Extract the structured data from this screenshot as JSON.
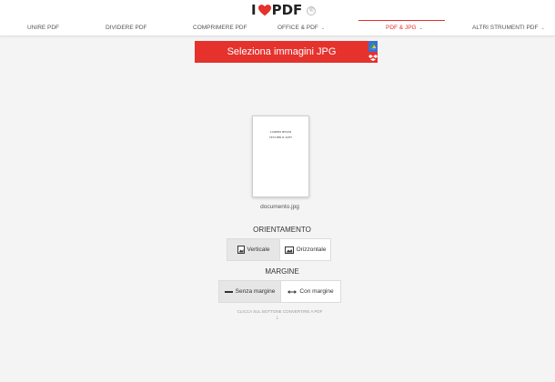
{
  "brand": {
    "prefix": "I",
    "name": "PDF",
    "badge": "®"
  },
  "nav": {
    "items": [
      {
        "label": "UNIRE PDF",
        "dropdown": false
      },
      {
        "label": "DIVIDERE PDF",
        "dropdown": false
      },
      {
        "label": "COMPRIMERE PDF",
        "dropdown": false
      },
      {
        "label": "OFFICE & PDF",
        "dropdown": true
      },
      {
        "label": "PDF & JPG",
        "dropdown": true,
        "active": true
      },
      {
        "label": "ALTRI STRUMENTI PDF",
        "dropdown": true
      }
    ],
    "chevron": "⌄"
  },
  "upload": {
    "select_label": "Seleziona immagini JPG",
    "icons": [
      "google-drive-icon",
      "dropbox-icon"
    ]
  },
  "file": {
    "name": "documento.jpg",
    "preview_lines": [
      "LOREM IPSUM",
      "TEST PER IL SOFT"
    ]
  },
  "orientation": {
    "title": "ORIENTAMENTO",
    "options": [
      {
        "label": "Verticale",
        "selected": true,
        "icon": "portrait-image-icon"
      },
      {
        "label": "Orizzontale",
        "selected": false,
        "icon": "landscape-image-icon"
      }
    ]
  },
  "margin": {
    "title": "MARGINE",
    "options": [
      {
        "label": "Senza margine",
        "selected": true,
        "icon": "no-margin-icon"
      },
      {
        "label": "Con margine",
        "selected": false,
        "icon": "margin-icon"
      }
    ]
  },
  "hint": {
    "text": "CLICCA SUL BOTTONE CONVERTIRE A PDF",
    "arrow": "↓"
  },
  "colors": {
    "accent": "#e5322d",
    "background": "#f4f4f4",
    "drive": "#3a6fd6"
  }
}
